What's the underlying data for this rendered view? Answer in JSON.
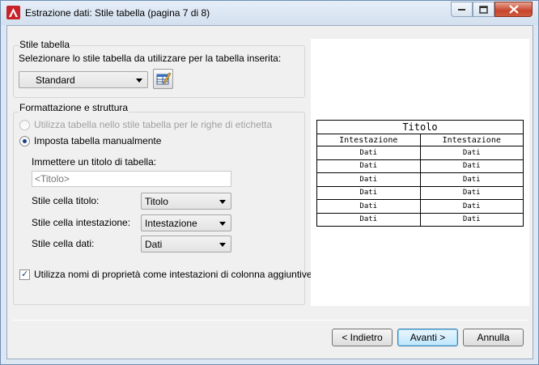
{
  "window": {
    "title": "Estrazione dati: Stile tabella (pagina 7 di 8)"
  },
  "table_style": {
    "group_label": "Stile tabella",
    "prompt": "Selezionare lo stile tabella da utilizzare per la tabella inserita:",
    "selected": "Standard"
  },
  "formatting": {
    "group_label": "Formattazione e struttura",
    "radio_use_style": "Utilizza tabella nello stile tabella per le righe di etichetta",
    "radio_manual": "Imposta tabella manualmente",
    "title_prompt": "Immettere un titolo di tabella:",
    "title_placeholder": "<Titolo>",
    "title_cell_label": "Stile cella titolo:",
    "title_cell_value": "Titolo",
    "header_cell_label": "Stile cella intestazione:",
    "header_cell_value": "Intestazione",
    "data_cell_label": "Stile cella dati:",
    "data_cell_value": "Dati",
    "checkbox_label": "Utilizza nomi di proprietà come intestazioni di colonna aggiuntive"
  },
  "preview": {
    "title": "Titolo",
    "headers": [
      "Intestazione",
      "Intestazione"
    ],
    "rows": [
      [
        "Dati",
        "Dati"
      ],
      [
        "Dati",
        "Dati"
      ],
      [
        "Dati",
        "Dati"
      ],
      [
        "Dati",
        "Dati"
      ],
      [
        "Dati",
        "Dati"
      ],
      [
        "Dati",
        "Dati"
      ]
    ]
  },
  "buttons": {
    "back": "< Indietro",
    "next": "Avanti >",
    "cancel": "Annulla"
  },
  "colors": {
    "accent": "#1a3f8a",
    "close_button": "#c7442b"
  }
}
